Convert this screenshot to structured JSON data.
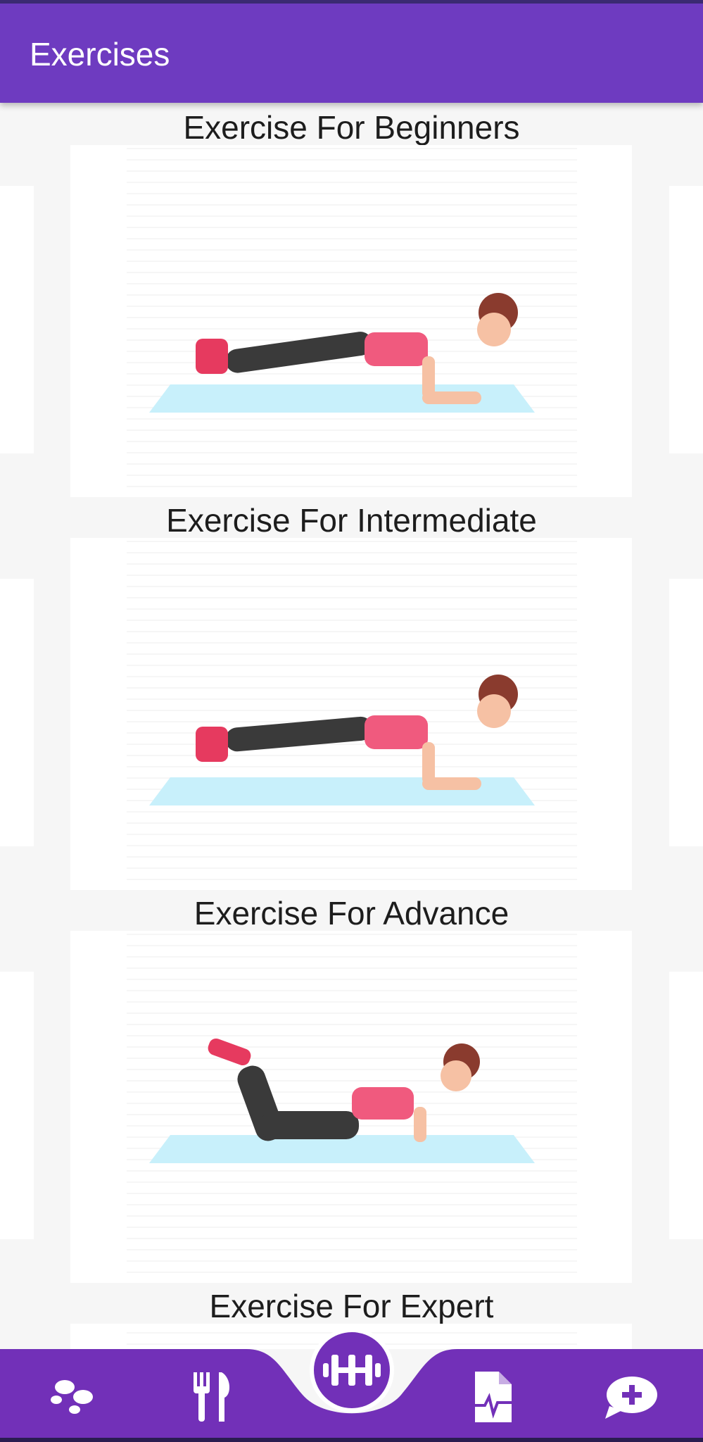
{
  "app": {
    "title": "Exercises"
  },
  "colors": {
    "primary": "#6e3bc0",
    "nav": "#7230b8",
    "mat": "#c8f0fb",
    "top": "#f05a7e",
    "shoe": "#e63a5f",
    "pants": "#3a3a3a",
    "skin": "#f6c1a4",
    "hair": "#8a3b2e"
  },
  "sections": [
    {
      "title": "Exercise For Beginners",
      "image": "plank-exercise-illustration"
    },
    {
      "title": "Exercise For Intermediate",
      "image": "plank-exercise-illustration"
    },
    {
      "title": "Exercise For Advance",
      "image": "knee-plank-exercise-illustration"
    },
    {
      "title": "Exercise For Expert",
      "image": "exercise-illustration"
    }
  ],
  "bottom_nav": [
    {
      "icon": "footsteps-icon"
    },
    {
      "icon": "fork-knife-icon"
    },
    {
      "icon": "dumbbell-icon",
      "active": true
    },
    {
      "icon": "health-report-icon"
    },
    {
      "icon": "chat-add-icon"
    }
  ]
}
